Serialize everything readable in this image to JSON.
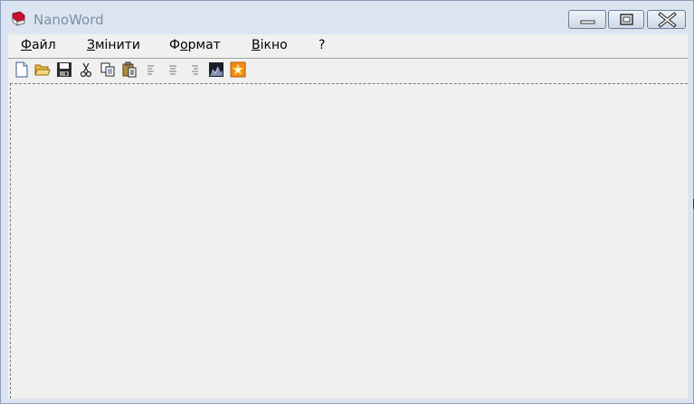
{
  "window": {
    "title": "NanoWord",
    "controls": {
      "minimize_icon": "minimize-icon",
      "maximize_icon": "maximize-icon",
      "close_icon": "close-icon"
    }
  },
  "menu": {
    "items": [
      {
        "accel": "Ф",
        "rest": "айл"
      },
      {
        "accel": "З",
        "rest": "мінити"
      },
      {
        "pre": "Ф",
        "accel": "о",
        "rest": "рмат"
      },
      {
        "accel": "В",
        "rest": "ікно"
      },
      {
        "accel": "",
        "rest": "?"
      }
    ]
  },
  "toolbar": {
    "buttons": [
      "new-document-icon",
      "open-folder-icon",
      "save-icon",
      "cut-icon",
      "copy-icon",
      "paste-icon",
      "align-left-icon",
      "align-center-icon",
      "align-right-icon",
      "image-icon",
      "star-icon"
    ]
  },
  "colors": {
    "titlebar": "#dbe4f0",
    "client": "#f0f0f0",
    "title_text": "#7e8ea2"
  }
}
